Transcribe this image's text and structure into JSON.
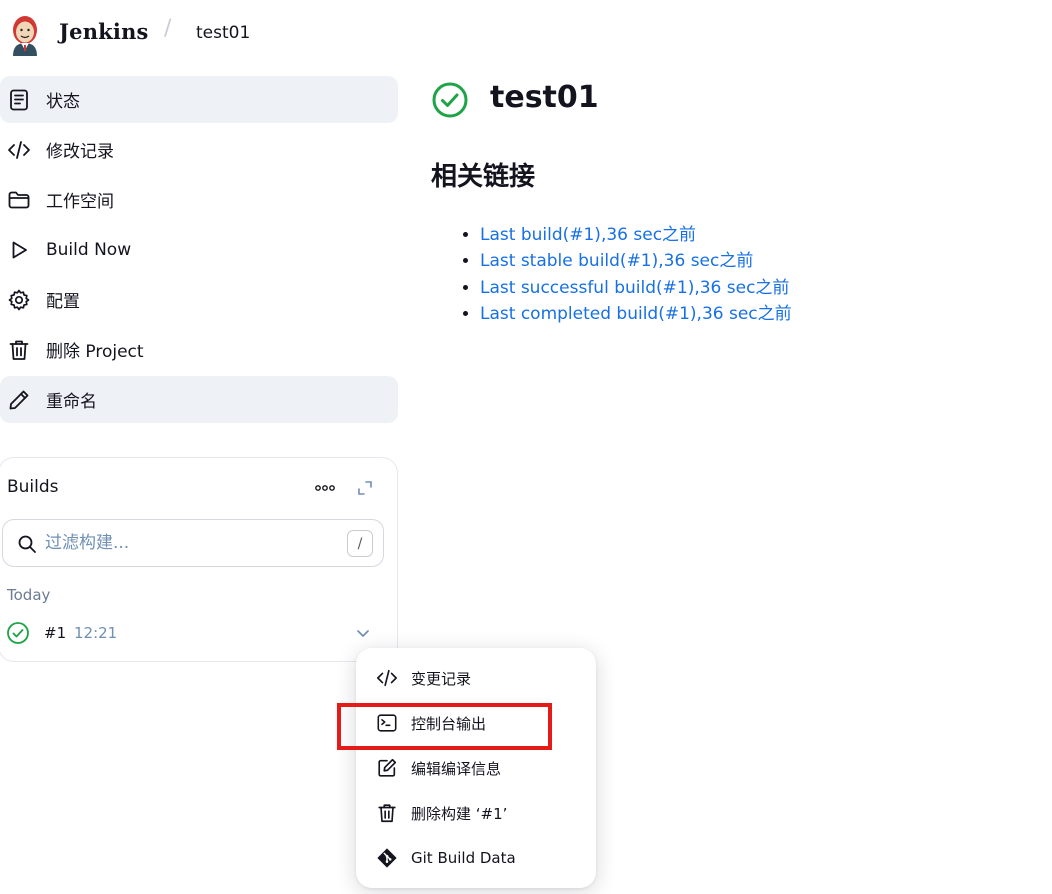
{
  "header": {
    "brand": "Jenkins",
    "breadcrumb_separator": "/",
    "breadcrumb_project": "test01"
  },
  "nav": {
    "items": [
      {
        "label": "状态",
        "icon": "document-icon",
        "active": true
      },
      {
        "label": "修改记录",
        "icon": "code-icon",
        "active": false
      },
      {
        "label": "工作空间",
        "icon": "folder-icon",
        "active": false
      },
      {
        "label": "Build Now",
        "icon": "play-icon",
        "active": false
      },
      {
        "label": "配置",
        "icon": "gear-icon",
        "active": false
      },
      {
        "label": "删除 Project",
        "icon": "trash-icon",
        "active": false
      },
      {
        "label": "重命名",
        "icon": "pencil-icon",
        "active": true
      }
    ]
  },
  "builds": {
    "title": "Builds",
    "search_placeholder": "过滤构建...",
    "shortcut": "/",
    "group_label": "Today",
    "rows": [
      {
        "number": "#1",
        "time": "12:21",
        "status": "success"
      }
    ]
  },
  "main": {
    "title": "test01",
    "section_title": "相关链接",
    "links": [
      "Last build(#1),36 sec之前",
      "Last stable build(#1),36 sec之前",
      "Last successful build(#1),36 sec之前",
      "Last completed build(#1),36 sec之前"
    ]
  },
  "context_menu": {
    "items": [
      {
        "label": "变更记录",
        "icon": "code-icon"
      },
      {
        "label": "控制台输出",
        "icon": "terminal-icon",
        "highlighted": true
      },
      {
        "label": "编辑编译信息",
        "icon": "edit-icon"
      },
      {
        "label": "删除构建 ‘#1’",
        "icon": "trash-icon"
      },
      {
        "label": "Git Build Data",
        "icon": "git-icon"
      }
    ]
  },
  "colors": {
    "success": "#1ea446",
    "link": "#1770e5",
    "active_bg": "#eef1f6",
    "highlight": "#e41b17",
    "muted": "#6f8fb5"
  }
}
